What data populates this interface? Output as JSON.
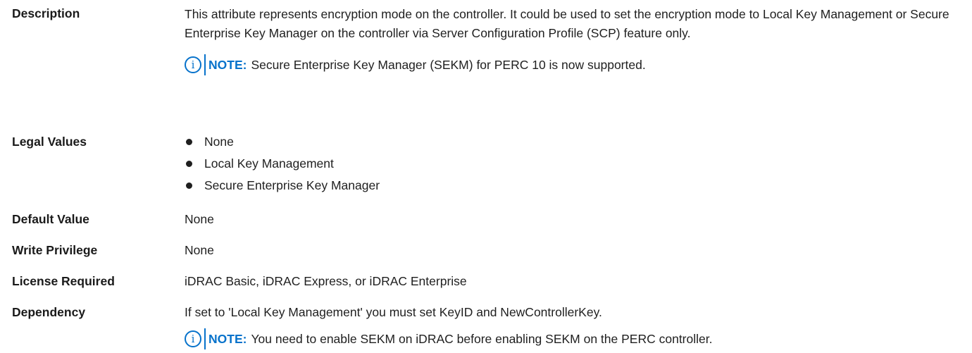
{
  "rows": {
    "description": {
      "label": "Description",
      "text": "This attribute represents encryption mode on the controller. It could be used to set the encryption mode to Local Key Management or Secure Enterprise Key Manager on the controller via Server Configuration Profile (SCP) feature only.",
      "note_label": "NOTE:",
      "note_text": "Secure Enterprise Key Manager (SEKM) for PERC 10 is now supported."
    },
    "legal_values": {
      "label": "Legal Values",
      "items": [
        "None",
        "Local Key Management",
        "Secure Enterprise Key Manager"
      ]
    },
    "default_value": {
      "label": "Default Value",
      "value": "None"
    },
    "write_privilege": {
      "label": "Write Privilege",
      "value": "None"
    },
    "license_required": {
      "label": "License Required",
      "value": "iDRAC Basic, iDRAC Express, or iDRAC Enterprise"
    },
    "dependency": {
      "label": "Dependency",
      "value": "If set to 'Local Key Management' you must set KeyID and NewControllerKey.",
      "note_label": "NOTE:",
      "note_text": "You need to enable SEKM on iDRAC before enabling SEKM on the PERC controller."
    }
  },
  "icons": {
    "note_icon": "info-icon",
    "note_icon_glyph": "i"
  },
  "colors": {
    "accent": "#0672cb",
    "text": "#1f1f1f"
  }
}
